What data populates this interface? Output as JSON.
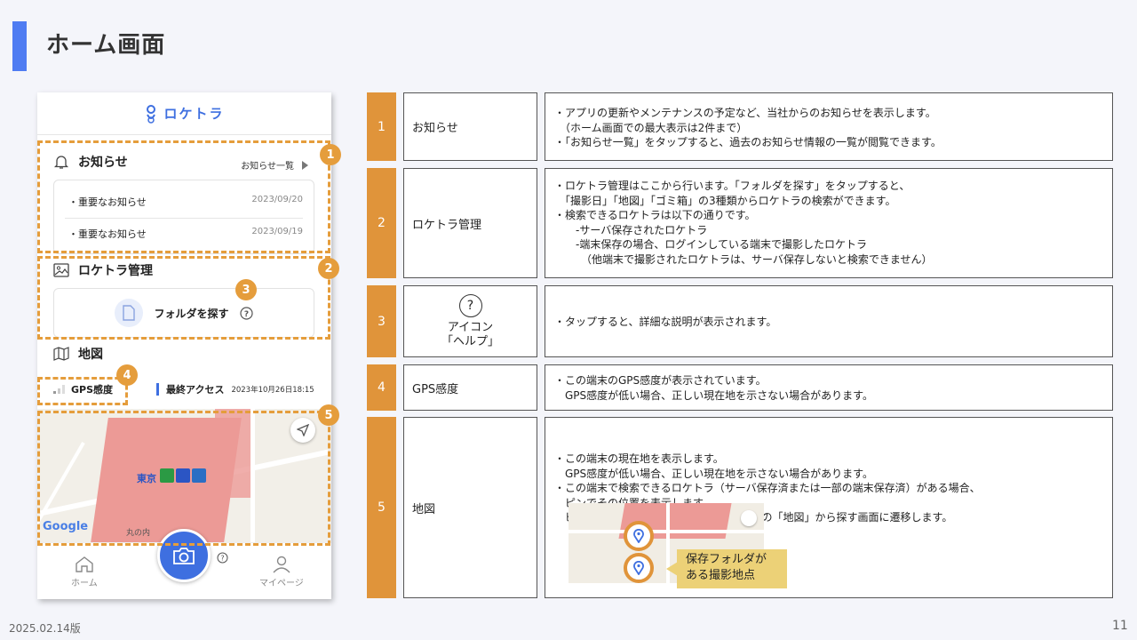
{
  "page": {
    "title": "ホーム画面",
    "version": "2025.02.14版",
    "page_number": "11"
  },
  "phone": {
    "logo_text": "ロケトラ",
    "notice": {
      "heading": "お知らせ",
      "link": "お知らせ一覧",
      "items": [
        {
          "title": "・重要なお知らせ",
          "date": "2023/09/20"
        },
        {
          "title": "・重要なお知らせ",
          "date": "2023/09/19"
        }
      ]
    },
    "locatra": {
      "heading": "ロケトラ管理",
      "folder_button": "フォルダを探す"
    },
    "map_section": {
      "heading": "地図"
    },
    "gps": {
      "label": "GPS感度",
      "level": 0.33
    },
    "last_access": {
      "label": "最終アクセス",
      "value": "2023年10月26日18:15"
    },
    "map": {
      "station": "東京",
      "area": "丸の内",
      "provider": "Google"
    },
    "nav": {
      "home": "ホーム",
      "mypage": "マイページ"
    }
  },
  "badges": [
    "1",
    "2",
    "3",
    "4",
    "5"
  ],
  "rows": [
    {
      "num": "1",
      "name": "お知らせ",
      "desc": "・アプリの更新やメンテナンスの予定など、当社からのお知らせを表示します。\n　（ホーム画面での最大表示は2件まで）\n・「お知らせ一覧」をタップすると、過去のお知らせ情報の一覧が閲覧できます。"
    },
    {
      "num": "2",
      "name": "ロケトラ管理",
      "desc": "・ロケトラ管理はここから行います。「フォルダを探す」をタップすると、\n　「撮影日」「地図」「ゴミ箱」の3種類からロケトラの検索ができます。\n・検索できるロケトラは以下の通りです。\n　　-サーバ保存されたロケトラ\n　　-端末保存の場合、ログインしている端末で撮影したロケトラ\n　　　（他端末で撮影されたロケトラは、サーバ保存しないと検索できません）"
    },
    {
      "num": "3",
      "name_line1": "アイコン",
      "name_line2": "「ヘルプ」",
      "icon": "help-icon",
      "desc": "・タップすると、詳細な説明が表示されます。"
    },
    {
      "num": "4",
      "name": "GPS感度",
      "desc": "・この端末のGPS感度が表示されています。\n　GPS感度が低い場合、正しい現在地を示さない場合があります。"
    },
    {
      "num": "5",
      "name": "地図",
      "desc": "・この端末の現在地を表示します。\n　GPS感度が低い場合、正しい現在地を示さない場合があります。\n・この端末で検索できるロケトラ（サーバ保存済または一部の端末保存済）がある場合、\n　ピンでその位置を表示します。\n　ピンをタップすると、「フォルダを探す」の「地図」から探す画面に遷移します。",
      "callout": "保存フォルダが\nある撮影地点"
    }
  ],
  "colors": {
    "accent": "#4f7cf2",
    "orange": "#e59d3c",
    "brand_blue": "#3e6fe0"
  }
}
